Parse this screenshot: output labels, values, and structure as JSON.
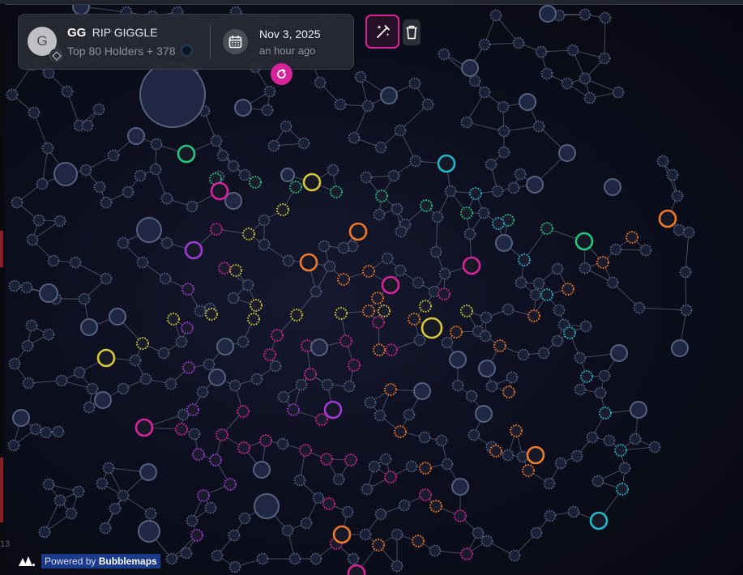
{
  "token": {
    "avatar_letter": "G",
    "symbol": "GG",
    "name": "RIP GIGGLE",
    "holders_text": "Top 80 Holders + 378",
    "chain_icon": "bnb-chain-icon"
  },
  "snapshot": {
    "date": "Nov 3, 2025",
    "ago": "an hour ago"
  },
  "toolbar": {
    "magic_icon": "magic-wand-icon",
    "trash_icon": "trash-icon",
    "refresh_icon": "refresh-icon"
  },
  "footer": {
    "powered_prefix": "Powered by",
    "powered_brand": "Bubblemaps",
    "corner_text": "13"
  },
  "colors": {
    "background": "#07080f",
    "accent": "#d6239a",
    "wallet_default": "#3d4a6b",
    "cluster_green": "#21c97a",
    "cluster_magenta": "#d6239a",
    "cluster_orange": "#f07a2a",
    "cluster_yellow": "#d7c93a",
    "cluster_cyan": "#23b7c9",
    "cluster_purple": "#a23ad6"
  }
}
